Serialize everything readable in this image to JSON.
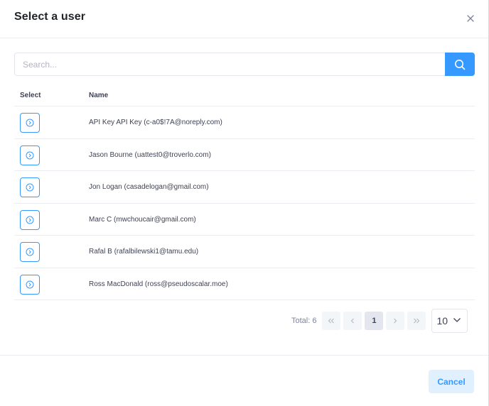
{
  "modal": {
    "title": "Select a user",
    "close_icon": "close-icon"
  },
  "search": {
    "placeholder": "Search...",
    "value": "",
    "button_icon": "search-icon"
  },
  "table": {
    "columns": [
      "Select",
      "Name"
    ],
    "rows": [
      {
        "name": "API Key API Key (c-a0$!7A@noreply.com)",
        "select_icon": "arrow-right-circle-icon"
      },
      {
        "name": "Jason Bourne (uattest0@troverlo.com)",
        "select_icon": "arrow-right-circle-icon"
      },
      {
        "name": "Jon Logan (casadelogan@gmail.com)",
        "select_icon": "arrow-right-circle-icon"
      },
      {
        "name": "Marc C (mwchoucair@gmail.com)",
        "select_icon": "arrow-right-circle-icon"
      },
      {
        "name": "Rafal B (rafalbilewski1@tamu.edu)",
        "select_icon": "arrow-right-circle-icon"
      },
      {
        "name": "Ross MacDonald (ross@pseudoscalar.moe)",
        "select_icon": "arrow-right-circle-icon"
      }
    ]
  },
  "pagination": {
    "total_label": "Total: 6",
    "first": "«",
    "prev": "‹",
    "current_page": "1",
    "next": "›",
    "last": "»",
    "page_size": "10"
  },
  "footer": {
    "cancel_label": "Cancel"
  },
  "colors": {
    "accent": "#3699ff",
    "accent_light": "#e1f0ff",
    "border": "#ebedf3",
    "text": "#3f4254"
  }
}
